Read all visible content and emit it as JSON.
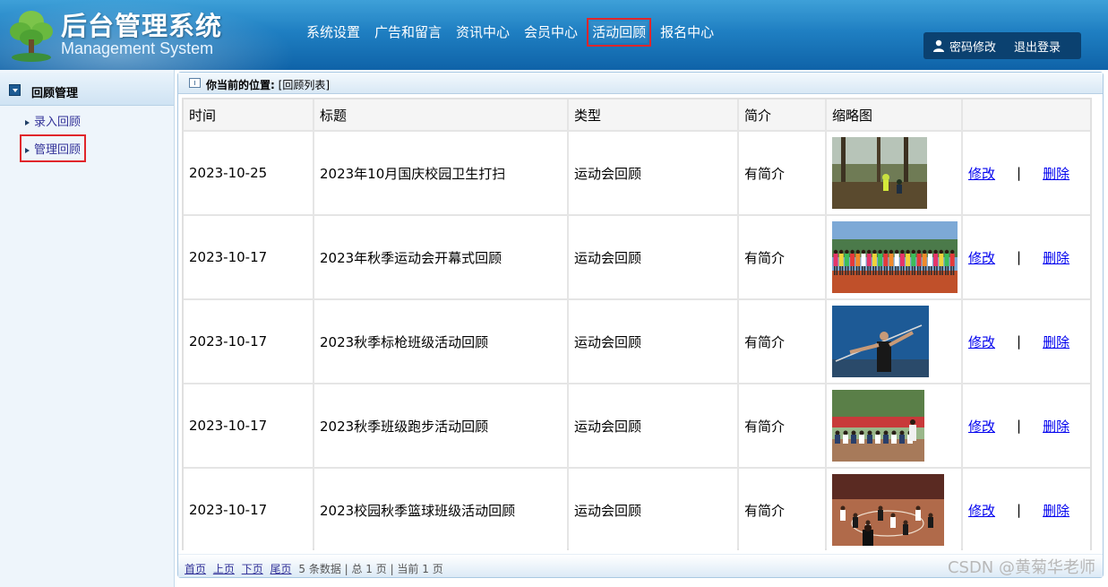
{
  "header": {
    "title": "后台管理系统",
    "subtitle": "Management System",
    "nav": [
      "系统设置",
      "广告和留言",
      "资讯中心",
      "会员中心",
      "活动回顾",
      "报名中心"
    ],
    "active_nav_index": 4,
    "change_password": "密码修改",
    "logout": "退出登录"
  },
  "sidebar": {
    "section_title": "回顾管理",
    "items": [
      "录入回顾",
      "管理回顾"
    ],
    "selected_index": 1
  },
  "breadcrumb": {
    "label": "你当前的位置:",
    "value": "[回顾列表]"
  },
  "table": {
    "columns": [
      "时间",
      "标题",
      "类型",
      "简介",
      "缩略图",
      ""
    ],
    "rows": [
      {
        "date": "2023-10-25",
        "title": "2023年10月国庆校园卫生打扫",
        "type": "运动会回顾",
        "summary": "有简介",
        "thumb": "cleaning-photo"
      },
      {
        "date": "2023-10-17",
        "title": "2023年秋季运动会开幕式回顾",
        "type": "运动会回顾",
        "summary": "有简介",
        "thumb": "opening-ceremony-photo"
      },
      {
        "date": "2023-10-17",
        "title": "2023秋季标枪班级活动回顾",
        "type": "运动会回顾",
        "summary": "有简介",
        "thumb": "javelin-photo"
      },
      {
        "date": "2023-10-17",
        "title": "2023秋季班级跑步活动回顾",
        "type": "运动会回顾",
        "summary": "有简介",
        "thumb": "running-photo"
      },
      {
        "date": "2023-10-17",
        "title": "2023校园秋季篮球班级活动回顾",
        "type": "运动会回顾",
        "summary": "有简介",
        "thumb": "basketball-photo"
      }
    ],
    "edit_label": "修改",
    "separator": "|",
    "delete_label": "删除"
  },
  "pager": {
    "first": "首页",
    "prev": "上页",
    "next": "下页",
    "last": "尾页",
    "info": "5 条数据 | 总 1 页 | 当前 1 页"
  },
  "watermark": "CSDN @黄菊华老师",
  "colors": {
    "header_blue": "#1f7fc2",
    "highlight_red": "#e0262b",
    "link_blue": "#0000ee"
  }
}
